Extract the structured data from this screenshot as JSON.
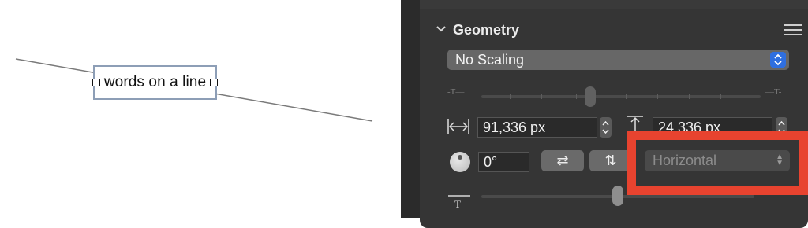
{
  "canvas": {
    "text_object": "words on a line"
  },
  "inspector": {
    "section_title": "Geometry",
    "scaling": {
      "selected": "No Scaling"
    },
    "slider_top": {
      "left_label": "-T—",
      "right_label": "—T-"
    },
    "width": {
      "value": "91,336 px"
    },
    "height": {
      "value": "24,336 px"
    },
    "rotation": {
      "value": "0°"
    },
    "flip_horizontal_glyph": "⇄",
    "flip_vertical_glyph": "⇅",
    "direction": {
      "selected": "Horizontal",
      "enabled": false
    },
    "slider_bottom": {
      "label": "T"
    }
  },
  "colors": {
    "highlight": "#e8432f",
    "accent": "#2f6fe0",
    "panel_bg": "#353535"
  }
}
